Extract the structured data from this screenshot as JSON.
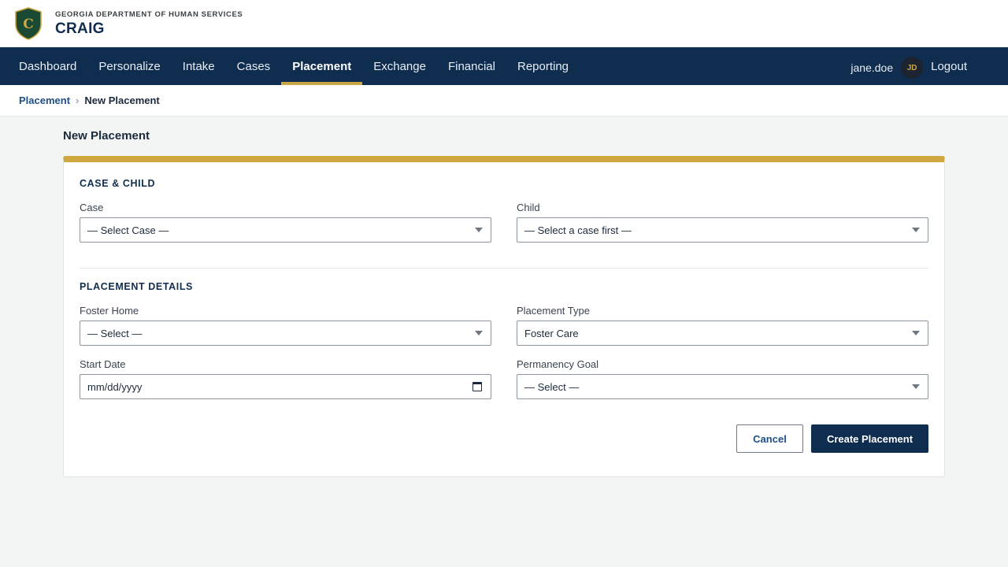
{
  "header": {
    "agency": "GEORGIA DEPARTMENT OF HUMAN SERVICES",
    "app_name": "CRAIG",
    "logo_letter": "C",
    "logo_icon": "shield-logo-icon"
  },
  "nav": {
    "items": [
      {
        "label": "Dashboard",
        "active": false
      },
      {
        "label": "Personalize",
        "active": false
      },
      {
        "label": "Intake",
        "active": false
      },
      {
        "label": "Cases",
        "active": false
      },
      {
        "label": "Placement",
        "active": true
      },
      {
        "label": "Exchange",
        "active": false
      },
      {
        "label": "Financial",
        "active": false
      },
      {
        "label": "Reporting",
        "active": false
      }
    ],
    "username": "jane.doe",
    "avatar_initials": "JD",
    "logout_label": "Logout"
  },
  "breadcrumb": {
    "parent": "Placement",
    "separator": "›",
    "current": "New Placement"
  },
  "page": {
    "title": "New Placement"
  },
  "form": {
    "case_child": {
      "heading": "CASE & CHILD",
      "case_label": "Case",
      "case_value": "— Select Case —",
      "child_label": "Child",
      "child_value": "— Select a case first —"
    },
    "placement_details": {
      "heading": "PLACEMENT DETAILS",
      "foster_home_label": "Foster Home",
      "foster_home_value": "— Select —",
      "placement_type_label": "Placement Type",
      "placement_type_value": "Foster Care",
      "start_date_label": "Start Date",
      "start_date_placeholder": "mm/dd/yyyy",
      "permanency_goal_label": "Permanency Goal",
      "permanency_goal_value": "— Select —"
    },
    "cancel_label": "Cancel",
    "submit_label": "Create Placement"
  },
  "colors": {
    "navy": "#0f2d4f",
    "gold": "#c9a744",
    "link": "#1f4d86",
    "background": "#f2f5f4"
  }
}
